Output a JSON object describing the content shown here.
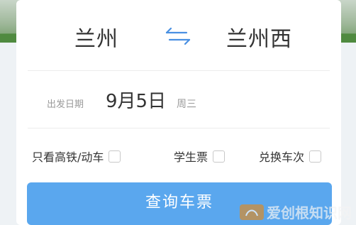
{
  "stations": {
    "from": "兰州",
    "to": "兰州西"
  },
  "date": {
    "label": "出发日期",
    "value": "9月5日",
    "weekday": "周三"
  },
  "options": [
    {
      "label": "只看高铁/动车",
      "checked": false
    },
    {
      "label": "学生票",
      "checked": false
    },
    {
      "label": "兑换车次",
      "checked": false
    }
  ],
  "search_button": {
    "label": "查询车票"
  },
  "watermark": {
    "text": "爱创根知识网"
  },
  "colors": {
    "accent": "#5aa7ee",
    "swap_icon": "#4a90e2",
    "text_primary": "#333333",
    "text_secondary": "#9a9a9a"
  }
}
